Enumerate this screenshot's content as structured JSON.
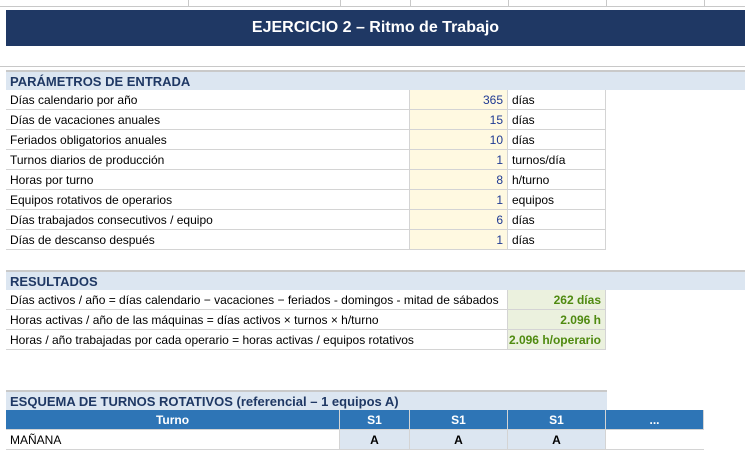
{
  "title": "EJERCICIO 2 – Ritmo de Trabajo",
  "params": {
    "heading": "PARÁMETROS DE ENTRADA",
    "rows": [
      {
        "label": "Días calendario por año",
        "value": "365",
        "unit": "días"
      },
      {
        "label": "Días de vacaciones anuales",
        "value": "15",
        "unit": "días"
      },
      {
        "label": "Feriados obligatorios anuales",
        "value": "10",
        "unit": "días"
      },
      {
        "label": "Turnos diarios de producción",
        "value": "1",
        "unit": "turnos/día"
      },
      {
        "label": "Horas por turno",
        "value": "8",
        "unit": "h/turno"
      },
      {
        "label": "Equipos rotativos de operarios",
        "value": "1",
        "unit": "equipos"
      },
      {
        "label": "Días trabajados consecutivos / equipo",
        "value": "6",
        "unit": "días"
      },
      {
        "label": "Días de descanso después",
        "value": "1",
        "unit": "días"
      }
    ]
  },
  "results": {
    "heading": "RESULTADOS",
    "rows": [
      {
        "label": "Días activos / año = días calendario − vacaciones − feriados - domingos - mitad de sábados",
        "value": "262 días"
      },
      {
        "label": "Horas activas / año de las máquinas = días activos × turnos × h/turno",
        "value": "2.096 h"
      },
      {
        "label": "Horas / año trabajadas por cada operario = horas activas / equipos rotativos",
        "value": "2.096 h/operario"
      }
    ]
  },
  "schedule": {
    "heading": "ESQUEMA DE TURNOS ROTATIVOS  (referencial – 1 equipos A)",
    "headers": [
      "Turno",
      "S1",
      "S1",
      "S1",
      "..."
    ],
    "row": {
      "label": "MAÑANA",
      "cells": [
        "A",
        "A",
        "A"
      ]
    }
  }
}
